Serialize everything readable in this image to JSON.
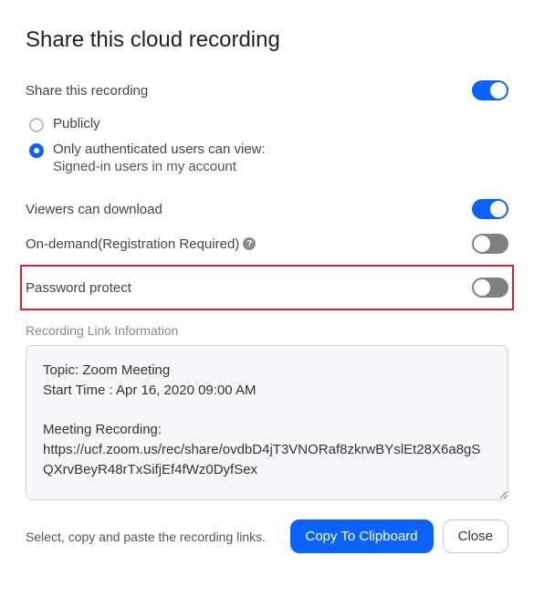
{
  "title": "Share this cloud recording",
  "share": {
    "label": "Share this recording",
    "enabled": true,
    "option_public": "Publicly",
    "option_auth_line1": "Only authenticated users can view:",
    "option_auth_line2": "Signed-in users in my account",
    "selected": "auth"
  },
  "download": {
    "label": "Viewers can download",
    "enabled": true
  },
  "ondemand": {
    "label": "On-demand(Registration Required)",
    "enabled": false
  },
  "password": {
    "label": "Password protect",
    "enabled": false
  },
  "link_section_label": "Recording Link Information",
  "link_info": "Topic: Zoom Meeting\nStart Time : Apr 16, 2020 09:00 AM\n\nMeeting Recording:\nhttps://ucf.zoom.us/rec/share/ovdbD4jT3VNORaf8zkrwBYslEt28X6a8gSQXrvBeyR48rTxSifjEf4fWz0DyfSex",
  "footer": {
    "hint": "Select, copy and paste the recording links.",
    "copy_label": "Copy To Clipboard",
    "close_label": "Close"
  },
  "colors": {
    "accent": "#0b63ff",
    "highlight_border": "#d9242b"
  }
}
